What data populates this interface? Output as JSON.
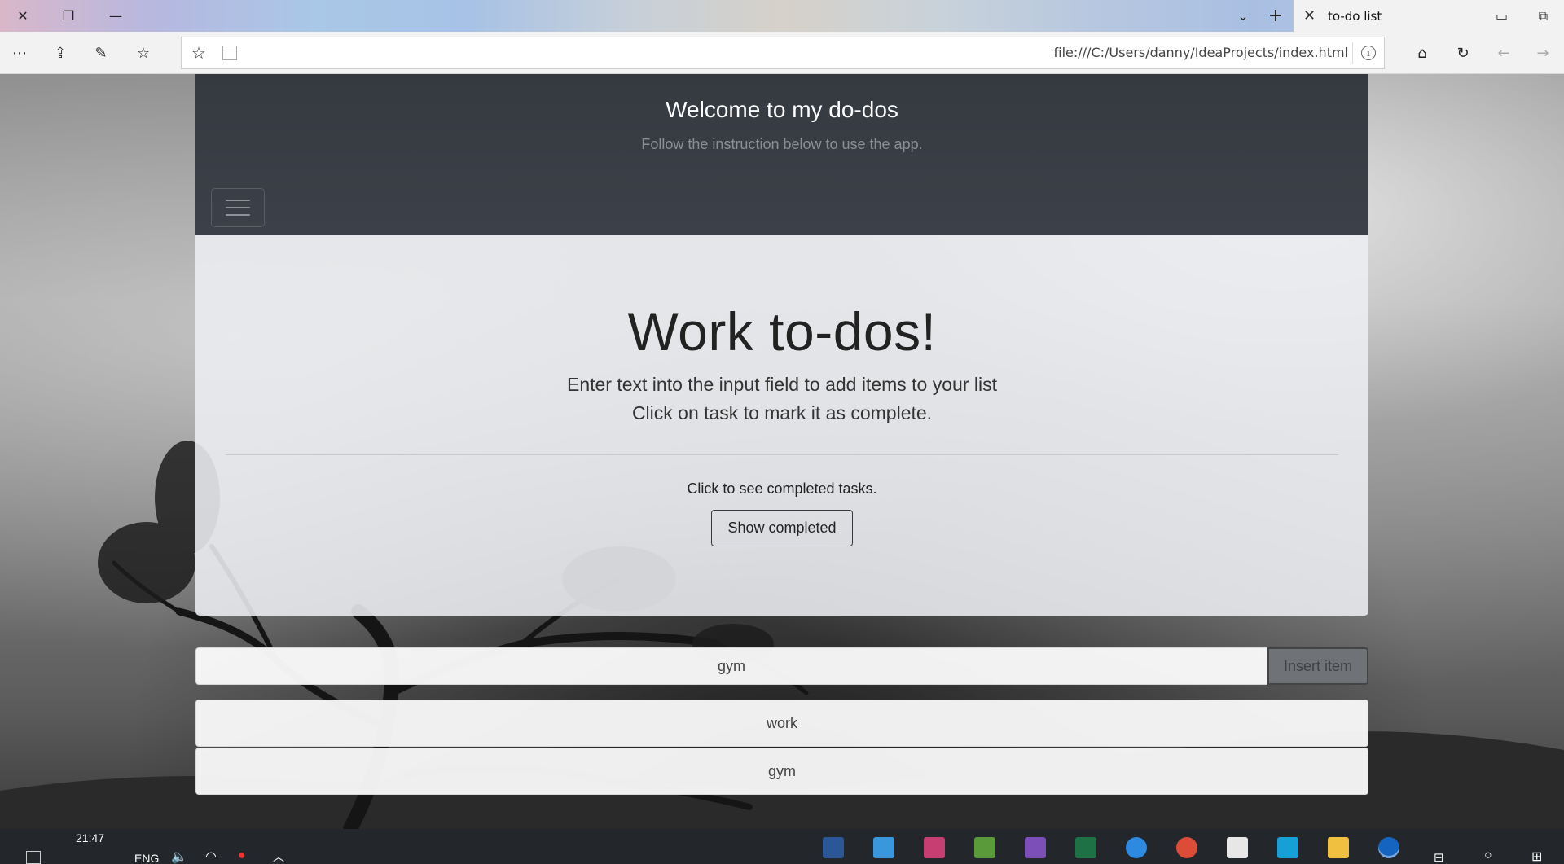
{
  "browser": {
    "tab_title": "to-do list",
    "url": "file:///C:/Users/danny/IdeaProjects/index.html"
  },
  "header": {
    "title": "Welcome to my do-dos",
    "subtitle": "Follow the instruction below to use the app."
  },
  "jumbotron": {
    "title": "Work to-dos!",
    "line1": "Enter text into the input field to add items to your list",
    "line2": "Click on task to mark it as complete.",
    "note": "Click to see completed tasks.",
    "show_completed_label": "Show completed"
  },
  "input": {
    "value": "gym",
    "insert_label": "Insert item"
  },
  "items": [
    "work",
    "gym"
  ],
  "taskbar": {
    "time": "21:47",
    "language": "ENG"
  },
  "colors": {
    "header_bg": "#353a41",
    "taskbar_bg": "#23262b"
  }
}
